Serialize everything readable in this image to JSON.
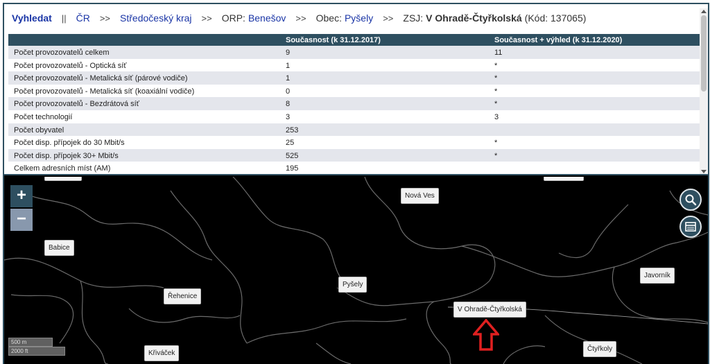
{
  "breadcrumb": {
    "search": "Vyhledat",
    "sep_main": "||",
    "cr": "ČR",
    "sep": ">>",
    "region": "Středočeský kraj",
    "orp_label": "ORP:",
    "orp_value": "Benešov",
    "obec_label": "Obec:",
    "obec_value": "Pyšely",
    "zsj_label": "ZSJ:",
    "zsj_value": "V Ohradě-Čtyřkolská",
    "code": "(Kód: 137065)"
  },
  "table": {
    "headers": [
      "",
      "Současnost (k 31.12.2017)",
      "Současnost + výhled (k 31.12.2020)"
    ],
    "rows": [
      [
        "Počet provozovatelů celkem",
        "9",
        "11"
      ],
      [
        "Počet provozovatelů - Optická síť",
        "1",
        "*"
      ],
      [
        "Počet provozovatelů - Metalická síť (párové vodiče)",
        "1",
        "*"
      ],
      [
        "Počet provozovatelů - Metalická síť (koaxiální vodiče)",
        "0",
        "*"
      ],
      [
        "Počet provozovatelů - Bezdrátová síť",
        "8",
        "*"
      ],
      [
        "Počet technologií",
        "3",
        "3"
      ],
      [
        "Počet obyvatel",
        "253",
        ""
      ],
      [
        "Počet disp. přípojek do 30 Mbit/s",
        "25",
        "*"
      ],
      [
        "Počet disp. přípojek 30+ Mbit/s",
        "525",
        "*"
      ],
      [
        "Celkem adresních míst (AM)",
        "195",
        ""
      ]
    ]
  },
  "map": {
    "zoom_in": "+",
    "zoom_out": "−",
    "places": {
      "nova_ves": "Nová Ves",
      "babice": "Babice",
      "rehenice": "Řehenice",
      "pysely": "Pyšely",
      "v_ohrade": "V Ohradě-Čtyřkolská",
      "javornik": "Javorník",
      "ctyrkoly": "Čtyřkoly",
      "krivacek": "Křiváček"
    },
    "scale_m": "500 m",
    "scale_ft": "2000 ft",
    "arrow_color": "#e02020"
  }
}
